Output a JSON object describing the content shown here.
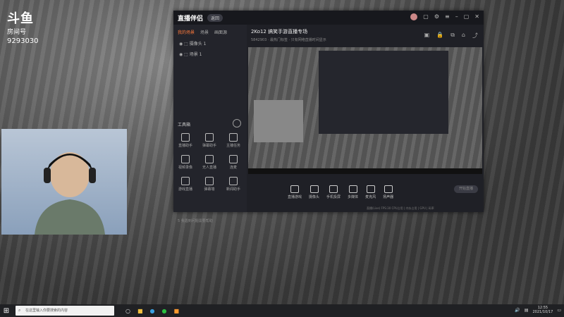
{
  "overlay": {
    "logo_text": "斗鱼",
    "room_label": "房间号",
    "room_id": "9293030"
  },
  "app": {
    "title": "直播伴侣",
    "badge": "返回",
    "sidebar_tabs": [
      "我的场景",
      "场景",
      "画面源"
    ],
    "scenes": [
      "摄像头 1",
      "场景 1"
    ],
    "tools_title": "工具箱",
    "tools": [
      "直播助手",
      "弹幕助手",
      "主播任务",
      "视频录像",
      "无人直播",
      "连麦",
      "游戏直播",
      "弹幕墙",
      "新闻助手",
      "",
      "",
      ""
    ],
    "hint": "5 我遇到问题需要帮助",
    "stream_title": "2Ko12  搞笑手游直播专场",
    "stream_sub": "5842903  · 最热门标签  · 只有网络直播时间显示",
    "controls": [
      "直播游戏",
      "摄像头",
      "手机投屏",
      "多媒体",
      "麦克风",
      "扬声器"
    ],
    "start_label": "开始直播",
    "status": "直播(Live)  FPS:30  CPU占用 | 内存占用 | GPU | 码率"
  },
  "taskbar": {
    "search_placeholder": "在这里输入你要搜索的内容",
    "time": "12:55",
    "date": "2021/10/17"
  }
}
